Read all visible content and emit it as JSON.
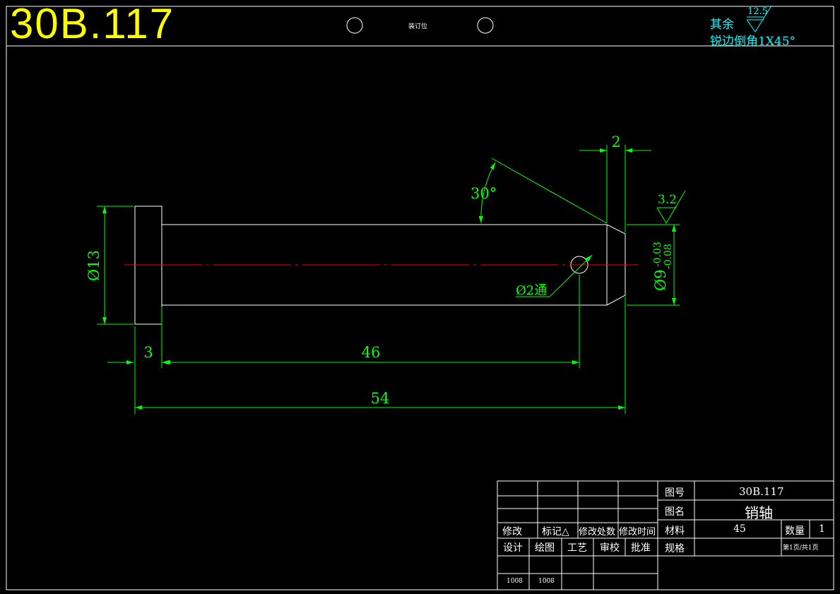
{
  "header": {
    "drawing_code_large": "30B.117",
    "binding_mark": "装订位",
    "note_rest": "其余",
    "note_chamfer": "锐边倒角1X45°",
    "roughness_general": "12.5"
  },
  "dimensions": {
    "head_dia": "Ø13",
    "head_len": "3",
    "hole_pos": "46",
    "total_len": "54",
    "chamfer_len": "2",
    "chamfer_angle": "30°",
    "hole_dia": "Ø2通",
    "shaft_dia": "Ø9",
    "shaft_tol_upper": "-0.03",
    "shaft_tol_lower": "-0.08",
    "roughness_shaft": "3.2"
  },
  "title_block": {
    "rev_headers": [
      "修改",
      "标记△",
      "修改处数",
      "修改时间"
    ],
    "sign_headers": [
      "设计",
      "绘图",
      "工艺",
      "审校",
      "批准"
    ],
    "sign_values": [
      "1008",
      "1008",
      "",
      "",
      ""
    ],
    "drawing_no_label": "图号",
    "drawing_no_value": "30B.117",
    "name_label": "图名",
    "name_value": "销轴",
    "material_label": "材料",
    "material_value": "45",
    "qty_label": "数量",
    "qty_value": "1",
    "spec_label": "规格",
    "page_info": "第1页/共1页"
  },
  "colors": {
    "background": "#000000",
    "outline": "#ffffff",
    "dimension": "#00ff00",
    "centerline": "#ff0000",
    "title": "#ffff00",
    "note": "#00ffff"
  }
}
